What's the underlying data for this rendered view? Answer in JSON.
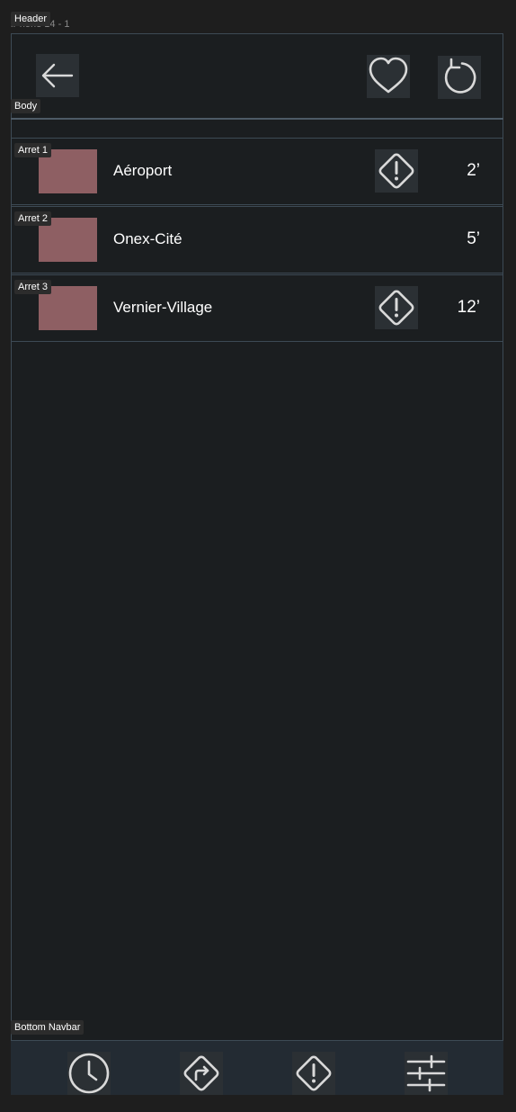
{
  "frame": {
    "name": "iPhone 14 - 1",
    "header_label": "Header",
    "body_label": "Body",
    "navbar_label": "Bottom Navbar"
  },
  "header": {
    "back_icon": "arrow-left-icon",
    "favorite_icon": "heart-icon",
    "refresh_icon": "refresh-icon"
  },
  "stops": [
    {
      "tag": "Arret 1",
      "name": "Aéroport",
      "eta": "2’",
      "has_alert": true
    },
    {
      "tag": "Arret 2",
      "name": "Onex-Cité",
      "eta": "5’",
      "has_alert": false
    },
    {
      "tag": "Arret 3",
      "name": "Vernier-Village",
      "eta": "12’",
      "has_alert": true
    }
  ],
  "navbar": {
    "items": [
      {
        "icon": "clock-icon"
      },
      {
        "icon": "directions-icon"
      },
      {
        "icon": "warning-icon"
      },
      {
        "icon": "sliders-icon"
      }
    ]
  },
  "colors": {
    "screen_bg": "#1b1e20",
    "canvas_bg": "#1e1e1e",
    "thumb": "#8e5f63",
    "icon_bg": "#2b3034",
    "icon_stroke": "#d9d9d9",
    "navbar_bg": "#232b33"
  }
}
